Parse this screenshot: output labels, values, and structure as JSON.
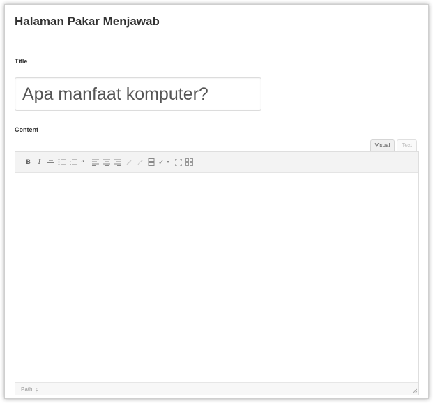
{
  "page": {
    "title": "Halaman Pakar Menjawab"
  },
  "form": {
    "title_label": "Title",
    "title_value": "Apa manfaat komputer?",
    "content_label": "Content"
  },
  "editor": {
    "tabs": [
      {
        "label": "Visual",
        "active": true
      },
      {
        "label": "Text",
        "active": false
      }
    ],
    "toolbar": [
      {
        "name": "bold-button",
        "glyph": "B"
      },
      {
        "name": "italic-button",
        "glyph": "I"
      },
      {
        "name": "strikethrough-button",
        "glyph": "strike-icon"
      },
      {
        "name": "bullet-list-button",
        "glyph": "bullet-list-icon"
      },
      {
        "name": "numbered-list-button",
        "glyph": "numbered-list-icon"
      },
      {
        "name": "blockquote-button",
        "glyph": "quote-icon"
      },
      {
        "name": "align-left-button",
        "glyph": "align-left-icon"
      },
      {
        "name": "align-center-button",
        "glyph": "align-center-icon"
      },
      {
        "name": "align-right-button",
        "glyph": "align-right-icon"
      },
      {
        "name": "insert-link-button",
        "glyph": "link-icon"
      },
      {
        "name": "unlink-button",
        "glyph": "unlink-icon"
      },
      {
        "name": "insert-more-button",
        "glyph": "more-icon"
      },
      {
        "name": "spellcheck-button",
        "glyph": "spellcheck-icon"
      },
      {
        "name": "fullscreen-button",
        "glyph": "fullscreen-icon"
      },
      {
        "name": "kitchen-sink-button",
        "glyph": "toolbar-toggle-icon"
      }
    ],
    "status_path": "Path: p"
  },
  "colors": {
    "text": "#333333",
    "border": "#dedede",
    "toolbar_bg": "#f3f3f3"
  }
}
